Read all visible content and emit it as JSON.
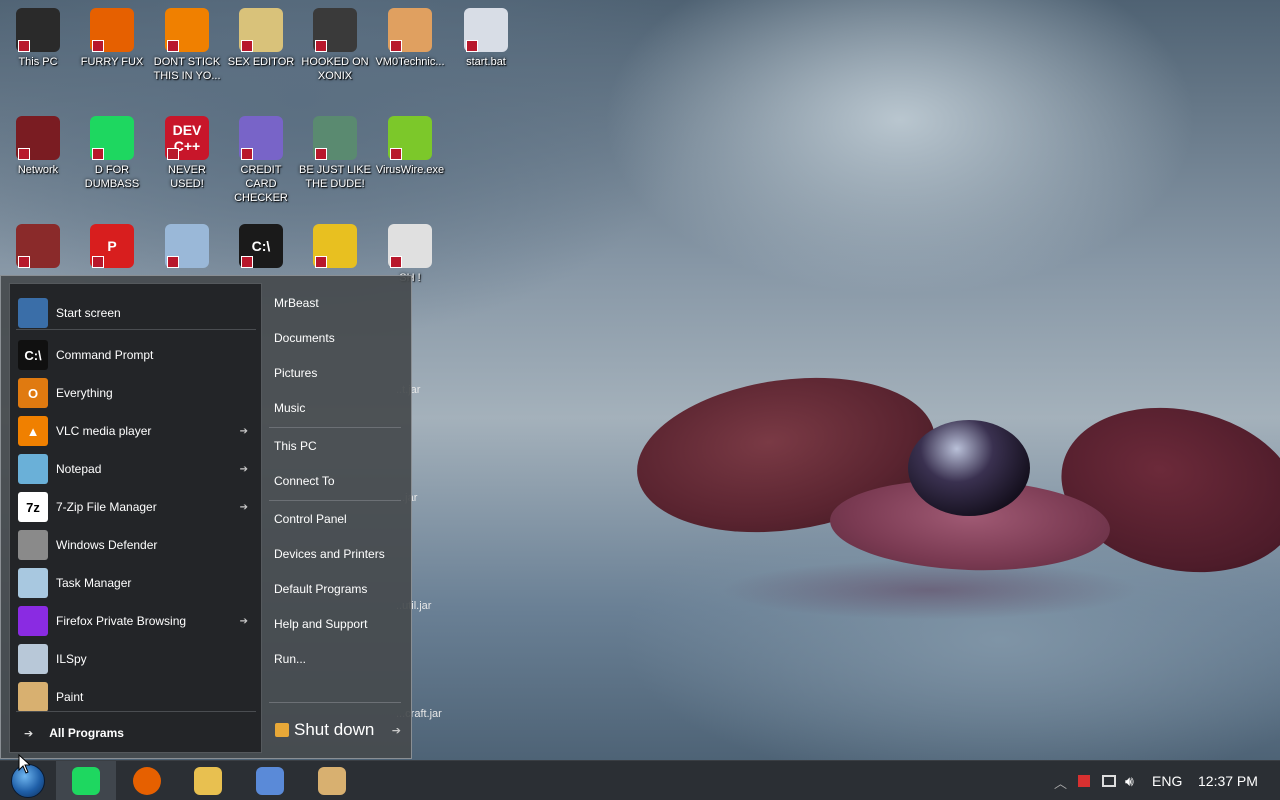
{
  "desktop_icons": [
    {
      "label": "This PC",
      "icon": "computer-icon",
      "color": "#2a2a2a"
    },
    {
      "label": "FURRY FUX",
      "icon": "firefox-icon",
      "color": "#e66000"
    },
    {
      "label": "DONT STICK THIS IN YO...",
      "icon": "vlc-cone-icon",
      "color": "#f08000"
    },
    {
      "label": "SEX EDITOR",
      "icon": "hxd-editor-icon",
      "color": "#d9c27a"
    },
    {
      "label": "HOOKED ON XONIX",
      "icon": "xonix-game-icon",
      "color": "#3a3a3a"
    },
    {
      "label": "VM0Technic...",
      "icon": "doctor-icon",
      "color": "#e0a060"
    },
    {
      "label": "start.bat",
      "icon": "batch-gear-icon",
      "color": "#d8dde6"
    },
    {
      "label": "Network",
      "icon": "network-icon",
      "color": "#7a1c22"
    },
    {
      "label": "D FOR DUMBASS",
      "icon": "green-chat-icon",
      "color": "#1ed760"
    },
    {
      "label": "NEVER USED!",
      "icon": "dev-cpp-icon",
      "color": "#c8162a",
      "text": "DEV C++"
    },
    {
      "label": "CREDIT CARD CHECKER",
      "icon": "credit-card-icon",
      "color": "#7864c8"
    },
    {
      "label": "BE JUST LIKE THE DUDE!",
      "icon": "santa-portrait-icon",
      "color": "#5a8a70"
    },
    {
      "label": "VirusWire.exe",
      "icon": "lime-icon",
      "color": "#7cc82a"
    },
    {
      "label": "",
      "icon": "paint-bucket-icon",
      "color": "#8a2a2a"
    },
    {
      "label": "",
      "icon": "p-logo-icon",
      "color": "#d81e1e",
      "text": "P"
    },
    {
      "label": "",
      "icon": "network-share-icon",
      "color": "#9ab8d8"
    },
    {
      "label": "",
      "icon": "console-icon",
      "color": "#1a1a1a",
      "text": "C:\\"
    },
    {
      "label": "",
      "icon": "beaver-icon",
      "color": "#e8c020"
    },
    {
      "label": "SH !",
      "icon": "game-box-icon",
      "color": "#e0e0e0"
    }
  ],
  "behind_menu_labels": [
    "..t.jar",
    "...jar",
    "..util.jar",
    "...craft.jar"
  ],
  "start_menu": {
    "programs": [
      {
        "label": "Start screen",
        "icon": "start-screen-icon",
        "arrow": false,
        "color": "#3a6ea8"
      },
      {
        "label": "Command Prompt",
        "icon": "command-prompt-icon",
        "arrow": false,
        "color": "#101010",
        "text": "C:\\"
      },
      {
        "label": "Everything",
        "icon": "magnifier-icon",
        "arrow": false,
        "color": "#e07a10",
        "text": "O"
      },
      {
        "label": "VLC media player",
        "icon": "vlc-icon",
        "arrow": true,
        "color": "#f08000",
        "text": "▲"
      },
      {
        "label": "Notepad",
        "icon": "notepad-icon",
        "arrow": true,
        "color": "#6ab0d8"
      },
      {
        "label": "7-Zip File Manager",
        "icon": "seven-zip-icon",
        "arrow": true,
        "color": "#ffffff",
        "text": "7z"
      },
      {
        "label": "Windows Defender",
        "icon": "defender-wall-icon",
        "arrow": false,
        "color": "#8a8a8a"
      },
      {
        "label": "Task Manager",
        "icon": "task-manager-icon",
        "arrow": false,
        "color": "#a8c8e0"
      },
      {
        "label": "Firefox Private Browsing",
        "icon": "firefox-private-icon",
        "arrow": true,
        "color": "#8a2be2"
      },
      {
        "label": "ILSpy",
        "icon": "ilspy-icon",
        "arrow": false,
        "color": "#b8c8d8"
      },
      {
        "label": "Paint",
        "icon": "paint-palette-icon",
        "arrow": false,
        "color": "#d8b070"
      }
    ],
    "all_programs_label": "All Programs",
    "links": [
      "MrBeast",
      "Documents",
      "Pictures",
      "Music",
      "This PC",
      "Connect To",
      "Control Panel",
      "Devices and Printers",
      "Default Programs",
      "Help and Support",
      "Run..."
    ],
    "shutdown_label": "Shut down"
  },
  "taskbar": {
    "pinned": [
      {
        "name": "green-chat-icon",
        "color": "#1ed760"
      },
      {
        "name": "firefox-icon",
        "color": "#e66000"
      },
      {
        "name": "file-explorer-icon",
        "color": "#e8c050"
      },
      {
        "name": "remote-desktop-icon",
        "color": "#5a8ad8"
      },
      {
        "name": "paint-palette-icon",
        "color": "#d8b070"
      }
    ],
    "language": "ENG",
    "clock": "12:37 PM"
  }
}
